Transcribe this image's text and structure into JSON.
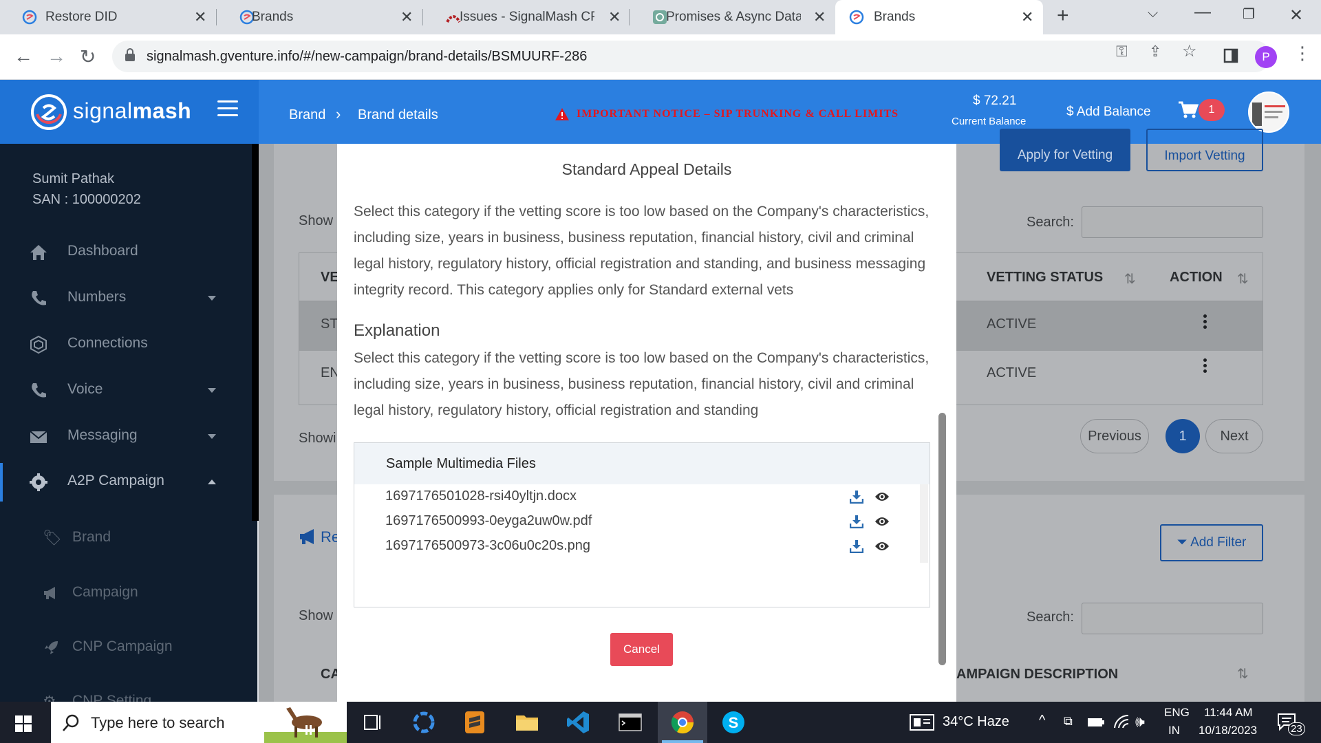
{
  "browser": {
    "tabs": [
      {
        "label": "Restore DID"
      },
      {
        "label": "Brands"
      },
      {
        "label": "Issues - SignalMash CPA"
      },
      {
        "label": "Promises & Async Data H"
      },
      {
        "label": "Brands"
      }
    ],
    "url": "signalmash.gventure.info/#/new-campaign/brand-details/BSMUURF-286",
    "profile_initial": "P"
  },
  "header": {
    "logo_light": "signal",
    "logo_bold": "mash",
    "breadcrumb": [
      "Brand",
      "Brand details"
    ],
    "notice": "IMPORTANT NOTICE – SIP TRUNKING & CALL LIMITS",
    "balance_amount": "$ 72.21",
    "balance_label": "Current Balance",
    "add_balance": "$ Add Balance",
    "cart_count": "1"
  },
  "sidebar": {
    "user_name": "Sumit Pathak",
    "user_san": "SAN : 100000202",
    "items": [
      {
        "label": "Dashboard",
        "icon": "home-icon"
      },
      {
        "label": "Numbers",
        "icon": "phone-icon"
      },
      {
        "label": "Connections",
        "icon": "network-icon"
      },
      {
        "label": "Voice",
        "icon": "phone-icon"
      },
      {
        "label": "Messaging",
        "icon": "envelope-icon"
      },
      {
        "label": "A2P Campaign",
        "icon": "gear-icon"
      }
    ],
    "sub_items": [
      {
        "label": "Brand",
        "icon": "tag-icon"
      },
      {
        "label": "Campaign",
        "icon": "megaphone-icon"
      },
      {
        "label": "CNP Campaign",
        "icon": "rocket-icon"
      },
      {
        "label": "CNP Setting",
        "icon": "settings-icon"
      }
    ]
  },
  "background": {
    "apply_vetting": "Apply for Vetting",
    "import_vetting": "Import Vetting",
    "show": "Show",
    "search_label": "Search:",
    "col_vetting": "VE",
    "col_vetting_status": "VETTING STATUS",
    "col_action": "ACTION",
    "rows": [
      {
        "prefix": "ST",
        "status": "ACTIVE"
      },
      {
        "prefix": "EN",
        "status": "ACTIVE"
      }
    ],
    "showing": "Showi",
    "pagination": {
      "previous": "Previous",
      "current": "1",
      "next": "Next"
    },
    "section2_prefix": "Re",
    "add_filter": "Add Filter",
    "show2": "Show",
    "search_label2": "Search:",
    "col_ca": "CA",
    "col_campaign_desc": "AMPAIGN DESCRIPTION"
  },
  "modal": {
    "title": "Standard Appeal Details",
    "description": "Select this category if the vetting score is too low based on the Company's characteristics, including size, years in business, business reputation, financial history, civil and criminal legal history, regulatory history, official registration and standing, and business messaging integrity record. This category applies only for Standard external vets",
    "explanation_heading": "Explanation",
    "explanation": "Select this category if the vetting score is too low based on the Company's characteristics, including size, years in business, business reputation, financial history, civil and criminal legal history, regulatory history, official registration and standing",
    "files_heading": "Sample Multimedia Files",
    "files": [
      "1697176501028-rsi40yltjn.docx",
      "1697176500993-0eyga2uw0w.pdf",
      "1697176500973-3c06u0c20s.png"
    ],
    "cancel": "Cancel"
  },
  "taskbar": {
    "search_placeholder": "Type here to search",
    "weather": "34°C  Haze",
    "lang_top": "ENG",
    "lang_bottom": "IN",
    "time": "11:44 AM",
    "date": "10/18/2023",
    "notification_count": "23"
  }
}
